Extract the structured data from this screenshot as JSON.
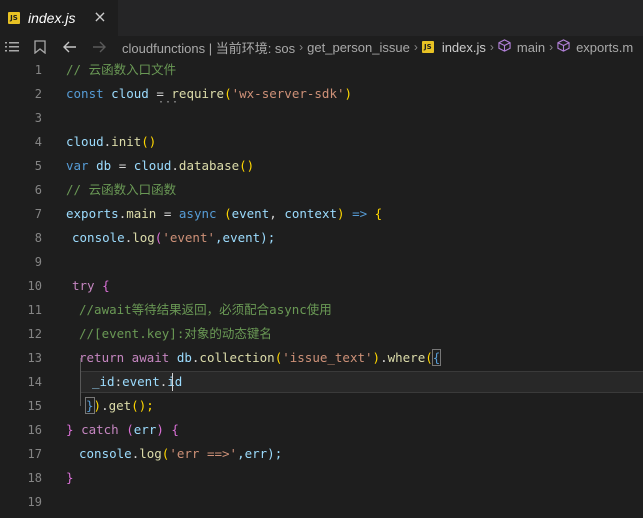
{
  "tab": {
    "label": "index.js",
    "badge": "JS",
    "close": "×"
  },
  "breadcrumb": {
    "items": [
      "cloudfunctions | 当前环境: sos",
      "get_person_issue",
      "index.js",
      "main",
      "exports.m"
    ],
    "separator": "›"
  },
  "code": {
    "line_numbers": [
      "1",
      "2",
      "3",
      "4",
      "5",
      "6",
      "7",
      "8",
      "9",
      "10",
      "11",
      "12",
      "13",
      "14",
      "15",
      "16",
      "17",
      "18",
      "19"
    ],
    "l1": "// 云函数入口文件",
    "l2": {
      "kw": "const",
      "name": " cloud ",
      "eq": "= ",
      "fn": "require",
      "open": "(",
      "str": "'wx-server-sdk'",
      "close": ")"
    },
    "l4": {
      "obj": "cloud",
      "dot": ".",
      "fn": "init",
      "paren": "()"
    },
    "l5": {
      "kw": "var",
      "name": " db ",
      "eq": "= ",
      "obj": "cloud",
      "dot": ".",
      "fn": "database",
      "paren": "()"
    },
    "l6": "// 云函数入口函数",
    "l7": {
      "obj": "exports",
      "dot": ".",
      "name": "main",
      "eq": " = ",
      "kw": "async",
      "open": " (",
      "p1": "event",
      "comma": ", ",
      "p2": "context",
      "close": ") ",
      "arrow": "=>",
      "brace": " {"
    },
    "l8": {
      "obj": "console",
      "dot": ".",
      "fn": "log",
      "open": "(",
      "str": "'event'",
      "rest": ",event);"
    },
    "l10": {
      "kw": "try",
      "brace": " {"
    },
    "l11": "//await等待结果返回，必须配合async使用",
    "l12": "//[event.key]:对象的动态键名",
    "l13": {
      "kw1": "return",
      "kw2": " await",
      "obj": " db",
      "dot": ".",
      "fn": "collection",
      "open": "(",
      "str": "'issue_text'",
      "close": ")",
      "dot2": ".",
      "fn2": "where",
      "open2": "(",
      "brace": "{"
    },
    "l14": {
      "key": "_id",
      "colon": ":",
      "obj": "event",
      "dot": ".",
      "prop": "id"
    },
    "l15": {
      "brace": "}",
      "close": ")",
      "dot": ".",
      "fn": "get",
      "rest": "();"
    },
    "l16": {
      "brace": "} ",
      "kw": "catch",
      "open": " (",
      "p": "err",
      "close": ")",
      "brace2": " {"
    },
    "l17": {
      "obj": "console",
      "dot": ".",
      "fn": "log",
      "open": "(",
      "str": "'err ==>'",
      "rest": ",err);"
    },
    "l18": {
      "brace": "}"
    }
  },
  "colors": {
    "background": "#1e1e1e",
    "keyword": "#569cd6",
    "control": "#c586c0",
    "function": "#dcdcaa",
    "string": "#ce9178",
    "comment": "#6a9955",
    "variable": "#9cdcfe",
    "js_badge": "#e8c224"
  }
}
